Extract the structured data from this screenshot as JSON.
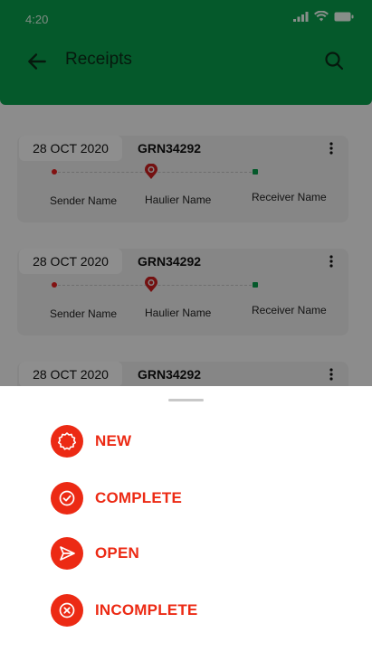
{
  "status_bar": {
    "time": "4:20"
  },
  "app_bar": {
    "title": "Receipts"
  },
  "receipts": [
    {
      "date": "28 OCT 2020",
      "grn": "GRN34292",
      "sender": "Sender Name",
      "haulier": "Haulier Name",
      "receiver": "Receiver Name"
    },
    {
      "date": "28 OCT 2020",
      "grn": "GRN34292",
      "sender": "Sender Name",
      "haulier": "Haulier Name",
      "receiver": "Receiver Name"
    },
    {
      "date": "28 OCT 2020",
      "grn": "GRN34292"
    }
  ],
  "sheet": {
    "options": [
      {
        "label": "NEW",
        "icon": "badge-icon"
      },
      {
        "label": "COMPLETE",
        "icon": "check-circle-icon"
      },
      {
        "label": "OPEN",
        "icon": "send-icon"
      },
      {
        "label": "INCOMPLETE",
        "icon": "x-circle-icon"
      }
    ]
  },
  "colors": {
    "brand_green": "#0a9a4a",
    "accent_red": "#ec2a14"
  }
}
